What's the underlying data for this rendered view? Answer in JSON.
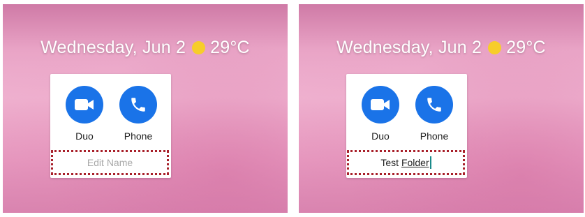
{
  "left_screen": {
    "date": "Wednesday, Jun 2",
    "temperature": "29°C",
    "weather_icon": "sun-icon",
    "apps": [
      {
        "label": "Duo",
        "icon": "video-camera-icon",
        "color": "#1a73e8"
      },
      {
        "label": "Phone",
        "icon": "phone-icon",
        "color": "#1a73e8"
      }
    ],
    "folder_name_placeholder": "Edit Name"
  },
  "right_screen": {
    "date": "Wednesday, Jun 2",
    "temperature": "29°C",
    "weather_icon": "sun-icon",
    "apps": [
      {
        "label": "Duo",
        "icon": "video-camera-icon",
        "color": "#1a73e8"
      },
      {
        "label": "Phone",
        "icon": "phone-icon",
        "color": "#1a73e8"
      }
    ],
    "folder_name_value_part1": "Test ",
    "folder_name_value_part2": "Folder"
  },
  "colors": {
    "accent_blue": "#1a73e8",
    "sun_yellow": "#f7cd2a",
    "highlight_border": "#a8202a"
  }
}
